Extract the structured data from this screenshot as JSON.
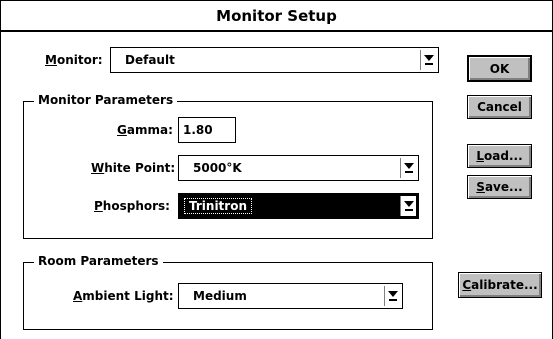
{
  "window": {
    "title": "Monitor Setup"
  },
  "monitor": {
    "label": "Monitor:",
    "label_key": "M",
    "label_rest": "onitor:",
    "value": "Default"
  },
  "monitor_parameters": {
    "title": "Monitor Parameters",
    "gamma": {
      "label_key": "G",
      "label_rest": "amma:",
      "value": "1.80"
    },
    "white_point": {
      "label_key": "W",
      "label_rest": "hite Point:",
      "value": "5000°K"
    },
    "phosphors": {
      "label_key": "P",
      "label_rest": "hosphors:",
      "value": "Trinitron"
    }
  },
  "room_parameters": {
    "title": "Room Parameters",
    "ambient_light": {
      "label_key": "A",
      "label_rest": "mbient Light:",
      "value": "Medium"
    }
  },
  "buttons": {
    "ok": "OK",
    "cancel": "Cancel",
    "load_key": "L",
    "load_rest": "oad...",
    "save_key": "S",
    "save_rest": "ave...",
    "calibrate_key": "C",
    "calibrate_rest": "alibrate..."
  }
}
